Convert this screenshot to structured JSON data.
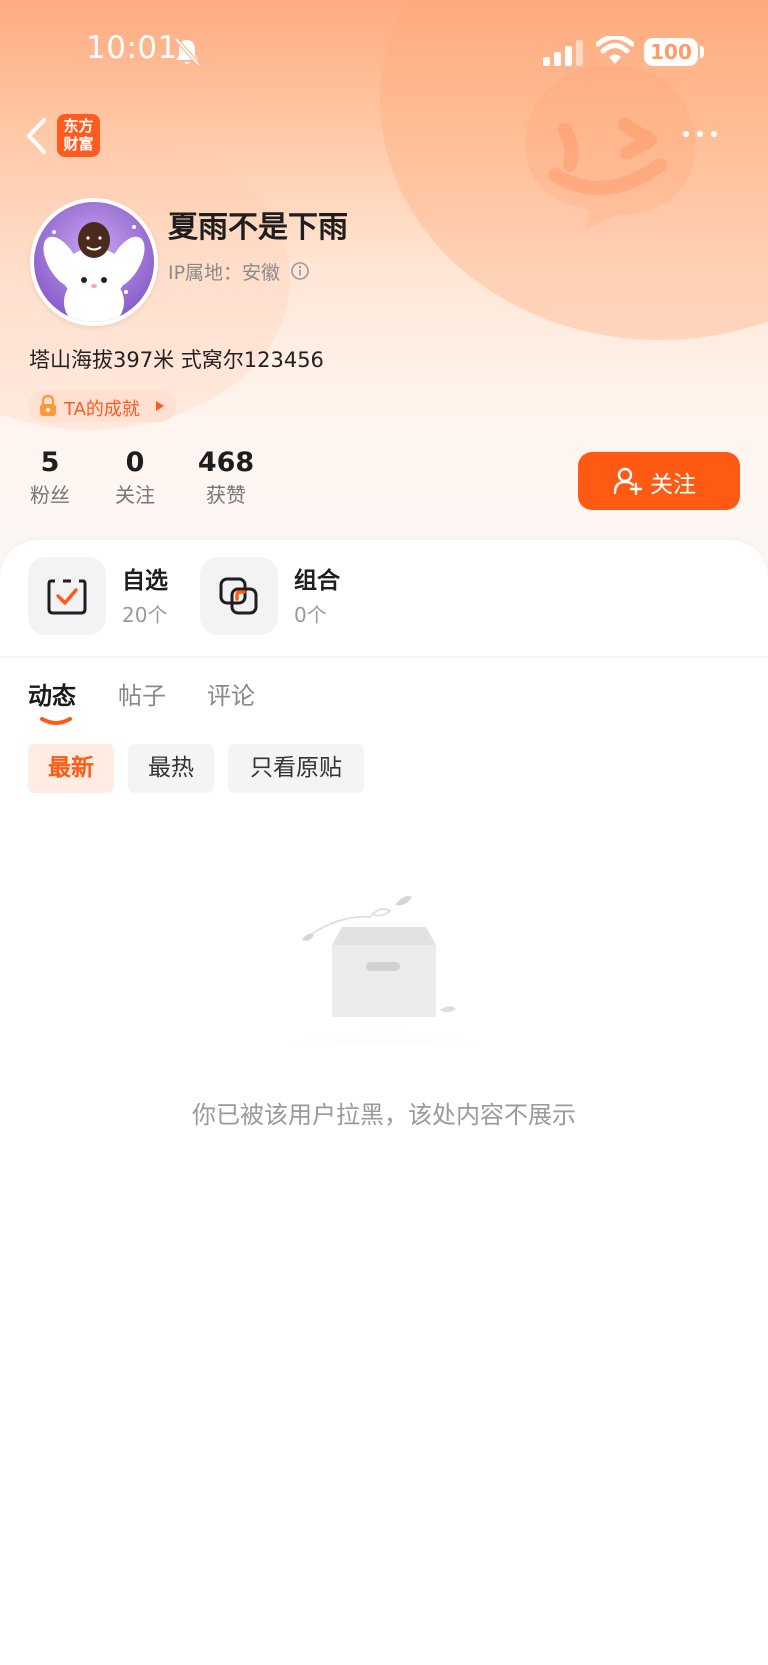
{
  "status_bar": {
    "time": "10:01",
    "battery": "100"
  },
  "nav": {
    "logo_line1": "东方",
    "logo_line2": "财富"
  },
  "profile": {
    "username": "夏雨不是下雨",
    "ip_location": "IP属地：安徽",
    "bio": "塔山海拔397米 式窝尔123456",
    "achievement_label": "TA的成就",
    "stats": [
      {
        "value": "5",
        "label": "粉丝"
      },
      {
        "value": "0",
        "label": "关注"
      },
      {
        "value": "468",
        "label": "获赞"
      }
    ],
    "follow_label": "关注"
  },
  "tools": [
    {
      "title": "自选",
      "count": "20个"
    },
    {
      "title": "组合",
      "count": "0个"
    }
  ],
  "tabs": [
    {
      "label": "动态",
      "active": true
    },
    {
      "label": "帖子",
      "active": false
    },
    {
      "label": "评论",
      "active": false
    }
  ],
  "filters": [
    {
      "label": "最新",
      "active": true
    },
    {
      "label": "最热",
      "active": false
    },
    {
      "label": "只看原贴",
      "active": false
    }
  ],
  "empty_state": {
    "message": "你已被该用户拉黑，该处内容不展示"
  },
  "colors": {
    "accent": "#ff5a14",
    "header_gradient_top": "#ffab80",
    "achievement_bg": "#ffe1d3"
  }
}
